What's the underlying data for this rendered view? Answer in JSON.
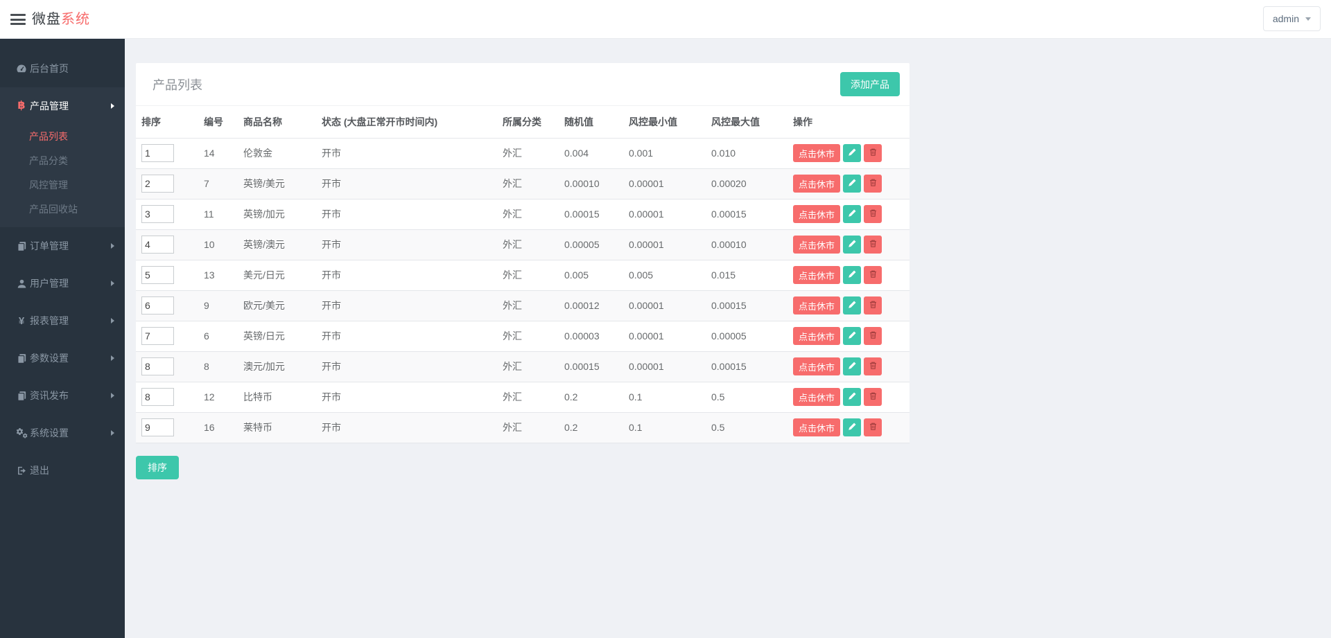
{
  "header": {
    "logo": {
      "primary": "微盘",
      "accent": "系统"
    },
    "user_menu_label": "admin"
  },
  "sidebar": {
    "items": [
      {
        "label": "后台首页",
        "icon": "dashboard-icon"
      },
      {
        "label": "产品管理",
        "icon": "bitcoin-icon",
        "expanded": true,
        "children": [
          {
            "label": "产品列表",
            "active": true
          },
          {
            "label": "产品分类"
          },
          {
            "label": "风控管理"
          },
          {
            "label": "产品回收站"
          }
        ]
      },
      {
        "label": "订单管理",
        "icon": "copy-icon"
      },
      {
        "label": "用户管理",
        "icon": "user-icon"
      },
      {
        "label": "报表管理",
        "icon": "yen-icon"
      },
      {
        "label": "参数设置",
        "icon": "copy-icon"
      },
      {
        "label": "资讯发布",
        "icon": "copy-icon"
      },
      {
        "label": "系统设置",
        "icon": "gears-icon"
      },
      {
        "label": "退出",
        "icon": "sign-out-icon"
      }
    ]
  },
  "panel": {
    "title": "产品列表",
    "add_button_label": "添加产品",
    "sort_button_label": "排序"
  },
  "table": {
    "headers": [
      "排序",
      "编号",
      "商品名称",
      "状态 (大盘正常开市时间内)",
      "所属分类",
      "随机值",
      "风控最小值",
      "风控最大值",
      "操作"
    ],
    "action_close_label": "点击休市",
    "rows": [
      {
        "sort": "1",
        "id": "14",
        "name": "伦敦金",
        "status": "开市",
        "category": "外汇",
        "random": "0.004",
        "risk_min": "0.001",
        "risk_max": "0.010"
      },
      {
        "sort": "2",
        "id": "7",
        "name": "英镑/美元",
        "status": "开市",
        "category": "外汇",
        "random": "0.00010",
        "risk_min": "0.00001",
        "risk_max": "0.00020"
      },
      {
        "sort": "3",
        "id": "11",
        "name": "英镑/加元",
        "status": "开市",
        "category": "外汇",
        "random": "0.00015",
        "risk_min": "0.00001",
        "risk_max": "0.00015"
      },
      {
        "sort": "4",
        "id": "10",
        "name": "英镑/澳元",
        "status": "开市",
        "category": "外汇",
        "random": "0.00005",
        "risk_min": "0.00001",
        "risk_max": "0.00010"
      },
      {
        "sort": "5",
        "id": "13",
        "name": "美元/日元",
        "status": "开市",
        "category": "外汇",
        "random": "0.005",
        "risk_min": "0.005",
        "risk_max": "0.015"
      },
      {
        "sort": "6",
        "id": "9",
        "name": "欧元/美元",
        "status": "开市",
        "category": "外汇",
        "random": "0.00012",
        "risk_min": "0.00001",
        "risk_max": "0.00015"
      },
      {
        "sort": "7",
        "id": "6",
        "name": "英镑/日元",
        "status": "开市",
        "category": "外汇",
        "random": "0.00003",
        "risk_min": "0.00001",
        "risk_max": "0.00005"
      },
      {
        "sort": "8",
        "id": "8",
        "name": "澳元/加元",
        "status": "开市",
        "category": "外汇",
        "random": "0.00015",
        "risk_min": "0.00001",
        "risk_max": "0.00015"
      },
      {
        "sort": "8",
        "id": "12",
        "name": "比特币",
        "status": "开市",
        "category": "外汇",
        "random": "0.2",
        "risk_min": "0.1",
        "risk_max": "0.5"
      },
      {
        "sort": "9",
        "id": "16",
        "name": "莱特币",
        "status": "开市",
        "category": "外汇",
        "random": "0.2",
        "risk_min": "0.1",
        "risk_max": "0.5"
      }
    ]
  },
  "colors": {
    "teal": "#3dc7ab",
    "coral": "#f76c6c",
    "sidebar-bg": "#28333e",
    "sidebar-active-bg": "#2e3945",
    "page-bg": "#eff1f5"
  }
}
